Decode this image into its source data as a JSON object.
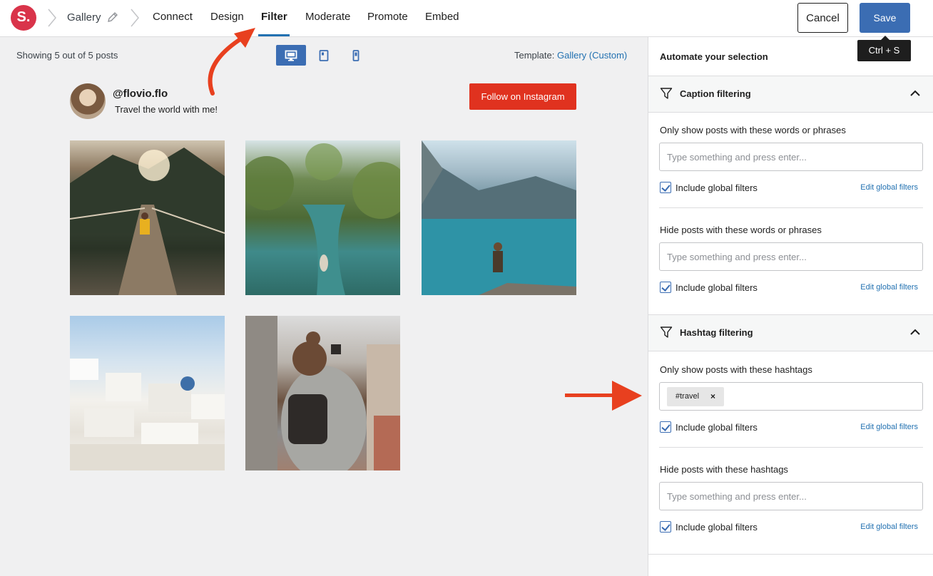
{
  "header": {
    "logo_letter": "S.",
    "breadcrumb_title": "Gallery",
    "tabs": [
      {
        "label": "Connect"
      },
      {
        "label": "Design"
      },
      {
        "label": "Filter"
      },
      {
        "label": "Moderate"
      },
      {
        "label": "Promote"
      },
      {
        "label": "Embed"
      }
    ],
    "active_tab": "Filter",
    "cancel_label": "Cancel",
    "save_label": "Save",
    "save_tooltip": "Ctrl + S"
  },
  "preview": {
    "showing_text": "Showing 5 out of 5 posts",
    "device_modes": [
      "desktop-icon",
      "tablet-icon",
      "phone-icon"
    ],
    "active_device": "desktop-icon",
    "template_label": "Template:",
    "template_value": "Gallery (Custom)",
    "profile": {
      "handle": "@flovio.flo",
      "bio": "Travel the world with me!",
      "follow_label": "Follow on Instagram"
    },
    "posts": [
      {
        "subject": "suspension-bridge-mountains"
      },
      {
        "subject": "palm-jungle-river"
      },
      {
        "subject": "mountain-lake-hiker"
      },
      {
        "subject": "white-village-hillside"
      },
      {
        "subject": "woman-with-backpack-city"
      }
    ]
  },
  "sidebar": {
    "title": "Automate your selection",
    "caption_section": {
      "title": "Caption filtering",
      "show_label": "Only show posts with these words or phrases",
      "show_placeholder": "Type something and press enter...",
      "hide_label": "Hide posts with these words or phrases",
      "hide_placeholder": "Type something and press enter...",
      "include_label": "Include global filters",
      "edit_link": "Edit global filters"
    },
    "hashtag_section": {
      "title": "Hashtag filtering",
      "show_label": "Only show posts with these hashtags",
      "show_tags": [
        "#travel"
      ],
      "hide_label": "Hide posts with these hashtags",
      "hide_placeholder": "Type something and press enter...",
      "include_label": "Include global filters",
      "edit_link": "Edit global filters"
    }
  },
  "colors": {
    "brand": "#d9344a",
    "accent": "#3b6db3",
    "instagram_red": "#e0321f",
    "annotation_arrow": "#e8401f"
  }
}
